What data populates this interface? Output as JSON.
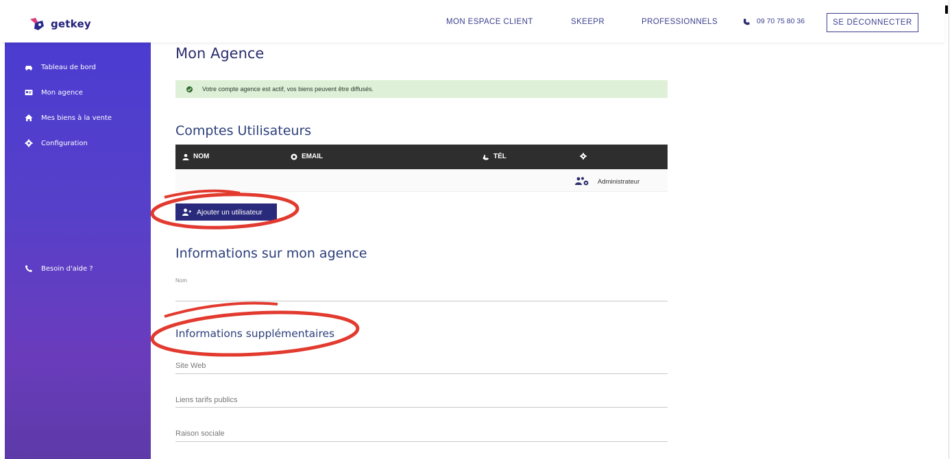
{
  "header": {
    "logo_text": "getkey",
    "nav": [
      "MON ESPACE CLIENT",
      "SKEEPR",
      "PROFESSIONNELS"
    ],
    "phone": "09 70 75 80 36",
    "logout_label": "SE DÉCONNECTER"
  },
  "sidebar": {
    "items": [
      {
        "label": "Tableau de bord",
        "icon": "car-icon"
      },
      {
        "label": "Mon agence",
        "icon": "id-card-icon"
      },
      {
        "label": "Mes biens à la vente",
        "icon": "home-icon"
      },
      {
        "label": "Configuration",
        "icon": "gear-icon"
      }
    ],
    "help_label": "Besoin d'aide ?"
  },
  "main": {
    "title": "Mon Agence",
    "alert_text": "Votre compte agence est actif, vos biens peuvent être diffusés.",
    "users_title": "Comptes Utilisateurs",
    "table_headers": [
      "NOM",
      "EMAIL",
      "TÉL"
    ],
    "user_role": "Administrateur",
    "add_user_label": "Ajouter un utilisateur",
    "info_title": "Informations sur mon agence",
    "nom_label": "Nom",
    "extra_title": "Informations supplémentaires",
    "site_web": "Site Web",
    "liens_tarifs": "Liens tarifs publics",
    "raison_sociale": "Raison sociale"
  },
  "colors": {
    "brand": "#23207a",
    "sidebar_top": "#4b3cd0",
    "sidebar_bottom": "#5d3aa8",
    "alert_bg": "#dff0d8",
    "table_head": "#2e2e2e",
    "annotation": "#e23a2e"
  }
}
